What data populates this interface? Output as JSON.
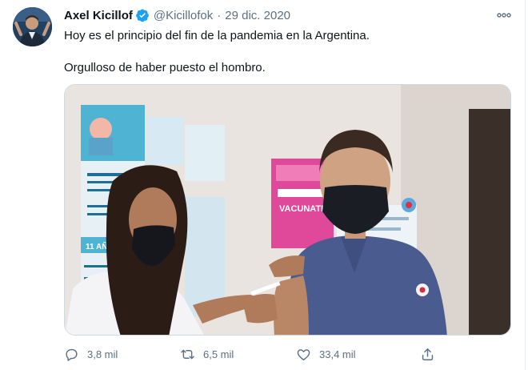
{
  "tweet": {
    "author_name": "Axel Kicillof",
    "handle": "@Kicillofok",
    "separator": "·",
    "date": "29 dic. 2020",
    "text_line1": "Hoy es el principio del fin de la pandemia en la Argentina.",
    "text_line2": "Orgulloso de haber puesto el hombro.",
    "poster_text": "VACUNATE",
    "poster_small": "11 AÑOS"
  },
  "actions": {
    "reply_count": "3,8 mil",
    "retweet_count": "6,5 mil",
    "like_count": "33,4 mil"
  },
  "colors": {
    "accent": "#1da1f2",
    "muted": "#5b7083",
    "text": "#0f1419"
  }
}
